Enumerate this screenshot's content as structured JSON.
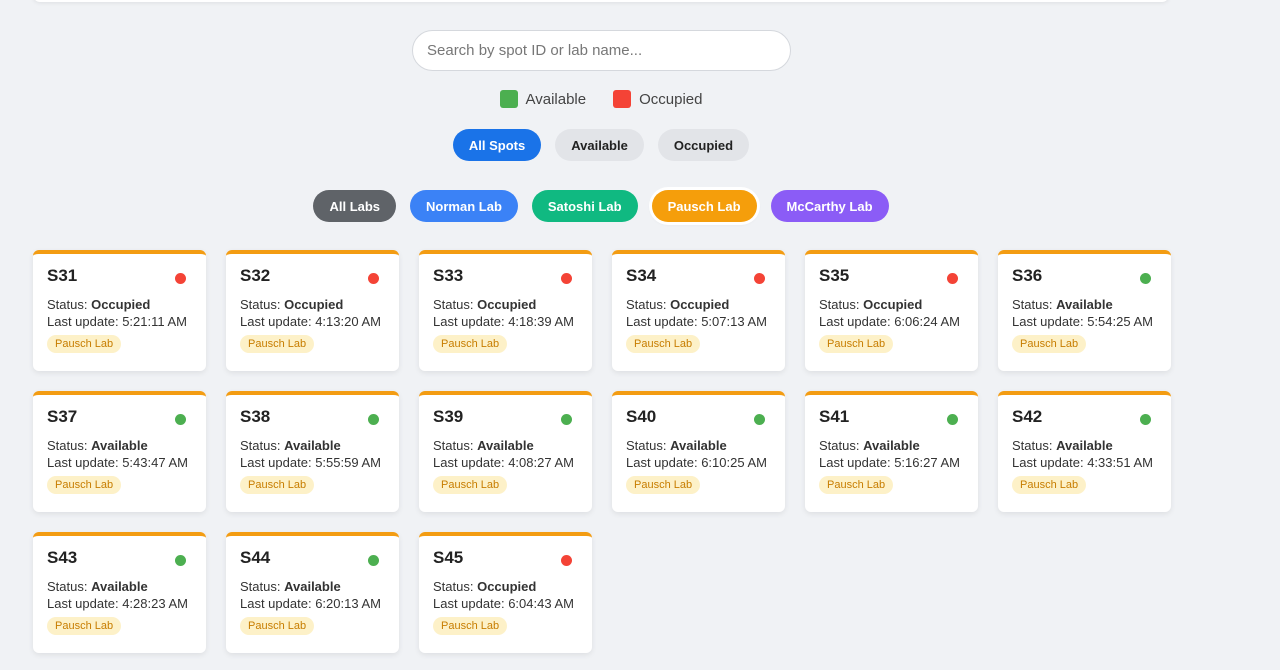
{
  "search": {
    "placeholder": "Search by spot ID or lab name..."
  },
  "legend": [
    {
      "label": "Available",
      "color": "#4caf50"
    },
    {
      "label": "Occupied",
      "color": "#f44336"
    }
  ],
  "status_filters": [
    {
      "label": "All Spots",
      "active": true
    },
    {
      "label": "Available",
      "active": false
    },
    {
      "label": "Occupied",
      "active": false
    }
  ],
  "lab_filters": [
    {
      "label": "All Labs",
      "color": "#5f6368",
      "selected": false
    },
    {
      "label": "Norman Lab",
      "color": "#3b82f6",
      "selected": false
    },
    {
      "label": "Satoshi Lab",
      "color": "#10b981",
      "selected": false
    },
    {
      "label": "Pausch Lab",
      "color": "#f59e0b",
      "selected": true
    },
    {
      "label": "McCarthy Lab",
      "color": "#8b5cf6",
      "selected": false
    }
  ],
  "labels": {
    "status": "Status:",
    "last_update": "Last update:"
  },
  "lab_badge": {
    "text_color": "#c77d00",
    "bg_color": "#fdf1c8",
    "accent": "#f39c12"
  },
  "spots": [
    {
      "id": "S31",
      "status": "Occupied",
      "time": "5:21:11 AM",
      "lab": "Pausch Lab"
    },
    {
      "id": "S32",
      "status": "Occupied",
      "time": "4:13:20 AM",
      "lab": "Pausch Lab"
    },
    {
      "id": "S33",
      "status": "Occupied",
      "time": "4:18:39 AM",
      "lab": "Pausch Lab"
    },
    {
      "id": "S34",
      "status": "Occupied",
      "time": "5:07:13 AM",
      "lab": "Pausch Lab"
    },
    {
      "id": "S35",
      "status": "Occupied",
      "time": "6:06:24 AM",
      "lab": "Pausch Lab"
    },
    {
      "id": "S36",
      "status": "Available",
      "time": "5:54:25 AM",
      "lab": "Pausch Lab"
    },
    {
      "id": "S37",
      "status": "Available",
      "time": "5:43:47 AM",
      "lab": "Pausch Lab"
    },
    {
      "id": "S38",
      "status": "Available",
      "time": "5:55:59 AM",
      "lab": "Pausch Lab"
    },
    {
      "id": "S39",
      "status": "Available",
      "time": "4:08:27 AM",
      "lab": "Pausch Lab"
    },
    {
      "id": "S40",
      "status": "Available",
      "time": "6:10:25 AM",
      "lab": "Pausch Lab"
    },
    {
      "id": "S41",
      "status": "Available",
      "time": "5:16:27 AM",
      "lab": "Pausch Lab"
    },
    {
      "id": "S42",
      "status": "Available",
      "time": "4:33:51 AM",
      "lab": "Pausch Lab"
    },
    {
      "id": "S43",
      "status": "Available",
      "time": "4:28:23 AM",
      "lab": "Pausch Lab"
    },
    {
      "id": "S44",
      "status": "Available",
      "time": "6:20:13 AM",
      "lab": "Pausch Lab"
    },
    {
      "id": "S45",
      "status": "Occupied",
      "time": "6:04:43 AM",
      "lab": "Pausch Lab"
    }
  ]
}
